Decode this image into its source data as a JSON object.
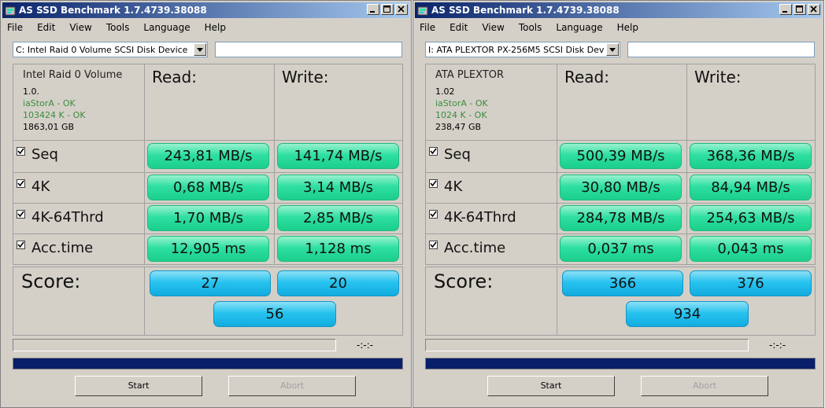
{
  "windows": [
    {
      "title": "AS SSD Benchmark 1.7.4739.38088",
      "menu": [
        "File",
        "Edit",
        "View",
        "Tools",
        "Language",
        "Help"
      ],
      "drive_select": "C: Intel Raid 0 Volume SCSI Disk Device",
      "device": {
        "name": "Intel Raid 0 Volume",
        "firmware": "1.0.",
        "driver_status": "iaStorA - OK",
        "alignment_status": "103424 K - OK",
        "size": "1863,01 GB"
      },
      "col_read": "Read:",
      "col_write": "Write:",
      "rows": [
        {
          "label": "Seq",
          "checked": true,
          "read": "243,81 MB/s",
          "write": "141,74 MB/s"
        },
        {
          "label": "4K",
          "checked": true,
          "read": "0,68 MB/s",
          "write": "3,14 MB/s"
        },
        {
          "label": "4K-64Thrd",
          "checked": true,
          "read": "1,70 MB/s",
          "write": "2,85 MB/s"
        },
        {
          "label": "Acc.time",
          "checked": true,
          "read": "12,905 ms",
          "write": "1,128 ms"
        }
      ],
      "score_label": "Score:",
      "score_read": "27",
      "score_write": "20",
      "score_total": "56",
      "time": "-:-:-",
      "start_label": "Start",
      "abort_label": "Abort"
    },
    {
      "title": "AS SSD Benchmark 1.7.4739.38088",
      "menu": [
        "File",
        "Edit",
        "View",
        "Tools",
        "Language",
        "Help"
      ],
      "drive_select": "I: ATA PLEXTOR PX-256M5 SCSI Disk Devic",
      "device": {
        "name": "ATA PLEXTOR",
        "firmware": "1.02",
        "driver_status": "iaStorA - OK",
        "alignment_status": "1024 K - OK",
        "size": "238,47 GB"
      },
      "col_read": "Read:",
      "col_write": "Write:",
      "rows": [
        {
          "label": "Seq",
          "checked": true,
          "read": "500,39 MB/s",
          "write": "368,36 MB/s"
        },
        {
          "label": "4K",
          "checked": true,
          "read": "30,80 MB/s",
          "write": "84,94 MB/s"
        },
        {
          "label": "4K-64Thrd",
          "checked": true,
          "read": "284,78 MB/s",
          "write": "254,63 MB/s"
        },
        {
          "label": "Acc.time",
          "checked": true,
          "read": "0,037 ms",
          "write": "0,043 ms"
        }
      ],
      "score_label": "Score:",
      "score_read": "366",
      "score_write": "376",
      "score_total": "934",
      "time": "-:-:-",
      "start_label": "Start",
      "abort_label": "Abort"
    }
  ],
  "colors": {
    "title_gradient_start": "#0a246a",
    "title_gradient_end": "#a6caf0",
    "result_green": "#2fe0a2",
    "score_blue": "#27c3ef",
    "progress_blue": "#0a1f6a",
    "ok_green": "#3c8c3c"
  },
  "icons": {
    "app": "as-ssd-app-icon",
    "minimize": "minimize-icon",
    "maximize": "maximize-icon",
    "close": "close-icon",
    "dropdown": "chevron-down-icon",
    "checkbox": "checkmark-icon"
  }
}
